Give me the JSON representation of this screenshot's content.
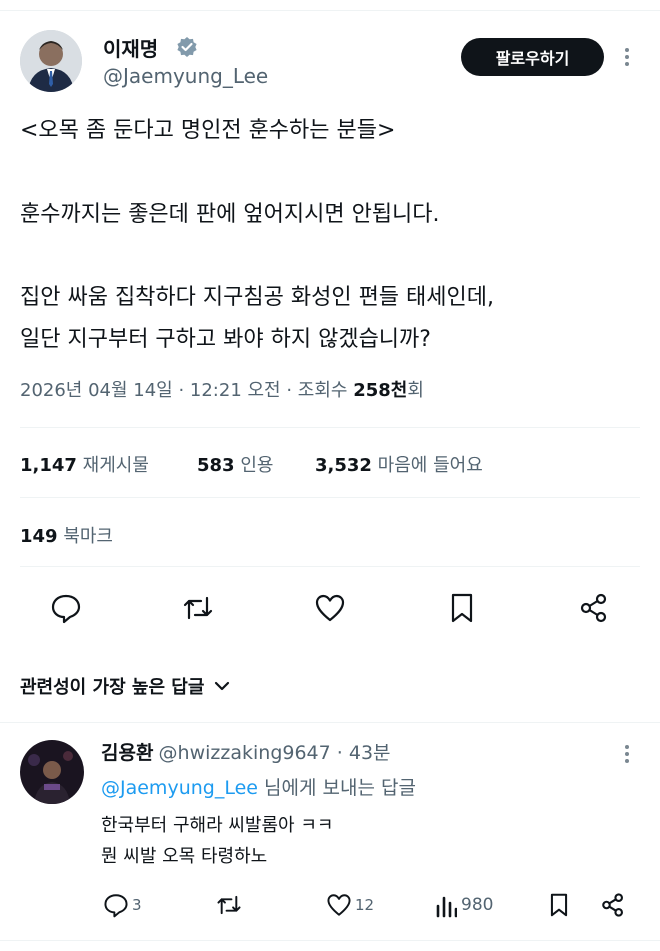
{
  "tweet": {
    "author_name": "이재명",
    "author_handle": "@Jaemyung_Lee",
    "follow_label": "팔로우하기",
    "lines": [
      "<오목 좀 둔다고 명인전 훈수하는 분들>",
      "훈수까지는 좋은데 판에 엎어지시면 안됩니다.",
      "집안 싸움 집착하다 지구침공 화성인 편들 태세인데,",
      "일단 지구부터 구하고 봐야 하지 않겠습니까?"
    ],
    "datetime": "2026년 04월 14일 · 12:21 오전 · 조회수 ",
    "views": "258천",
    "views_suffix": "회"
  },
  "stats": {
    "retweets": "1,147",
    "retweets_label": "재게시물",
    "quotes": "583",
    "quotes_label": "인용",
    "likes": "3,532",
    "likes_label": "마음에 들어요",
    "bookmarks": "149",
    "bookmarks_label": "북마크"
  },
  "sort_label": "관련성이 가장 높은 답글",
  "reply": {
    "name": "김용환",
    "handle": "@hwizzaking9647 · 43분",
    "to_prefix": "",
    "to_handle": "@Jaemyung_Lee",
    "to_suffix": " 님에게 보내는 답글",
    "lines": [
      "한국부터 구해라 씨발롬아 ㅋㅋ",
      "뭔 씨발 오목 타령하노"
    ],
    "replies_count": "3",
    "likes_count": "12",
    "views_count": "980"
  },
  "colors": {
    "accent": "#1d9bf0",
    "text": "#0f1419",
    "muted": "#536471"
  }
}
